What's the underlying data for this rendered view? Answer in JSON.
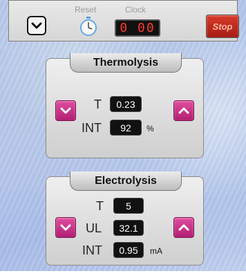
{
  "toolbar": {
    "reset_label": "Reset",
    "clock_label": "Clock",
    "clock_value": "0 00",
    "stop_label": "Stop"
  },
  "thermolysis": {
    "title": "Thermolysis",
    "t_label": "T",
    "t_value": "0.23",
    "int_label": "INT",
    "int_value": "92",
    "int_unit": "%"
  },
  "electrolysis": {
    "title": "Electrolysis",
    "t_label": "T",
    "t_value": "5",
    "ul_label": "UL",
    "ul_value": "32.1",
    "int_label": "INT",
    "int_value": "0.95",
    "int_unit": "mA"
  },
  "colors": {
    "accent_pink": "#c72f86",
    "clock_red": "#ff3a2a",
    "stop_red": "#c1291d"
  },
  "icons": [
    "chevron-down-icon",
    "stopwatch-icon",
    "chevron-up-icon"
  ]
}
